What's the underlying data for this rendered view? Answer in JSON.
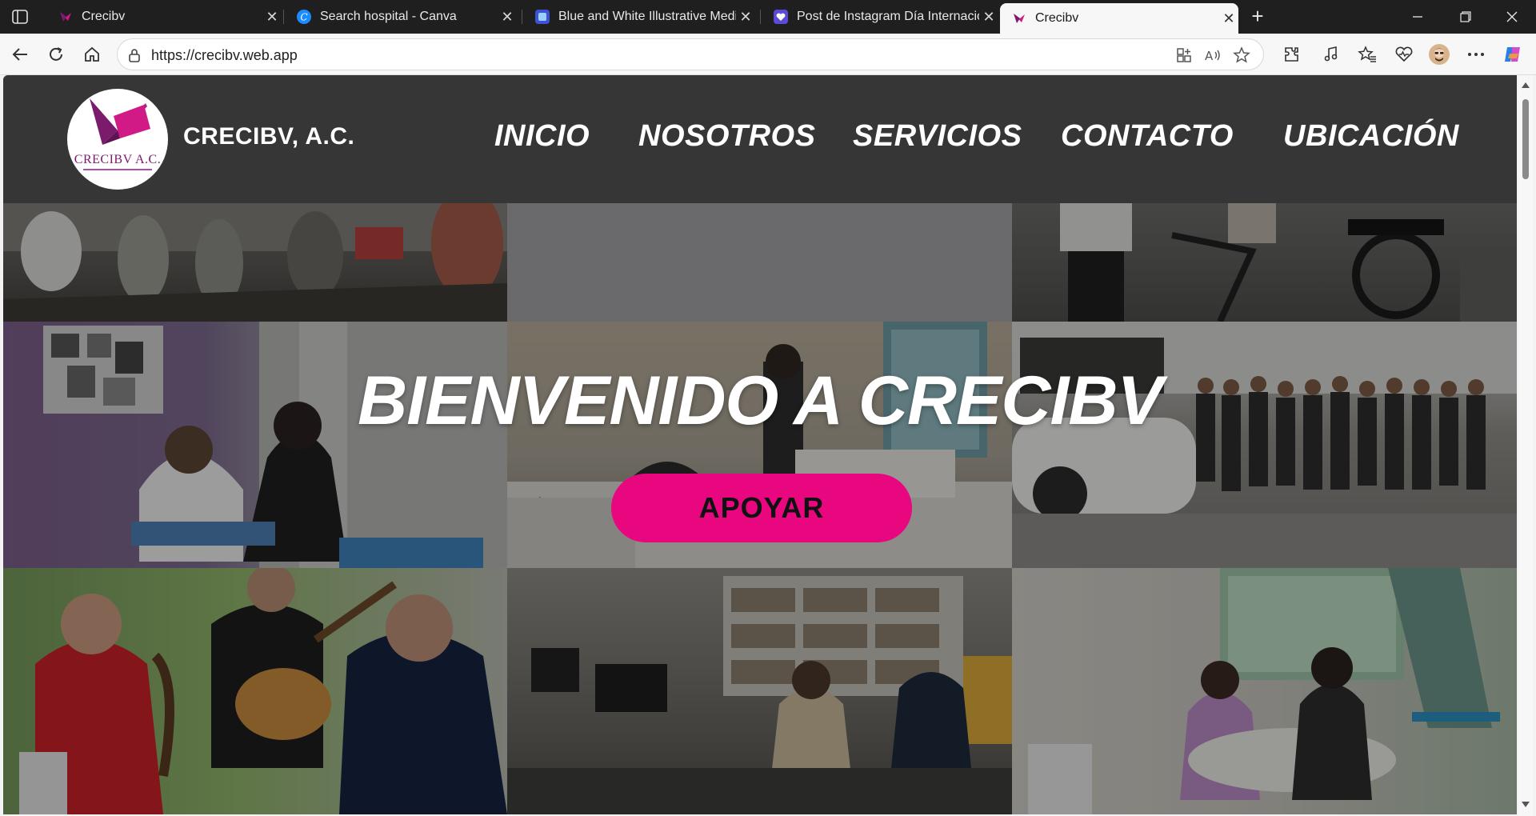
{
  "browser": {
    "tabs": [
      {
        "title": "Crecibv",
        "active": false
      },
      {
        "title": "Search hospital - Canva",
        "active": false
      },
      {
        "title": "Blue and White Illustrative Medical",
        "active": false
      },
      {
        "title": "Post de Instagram Día Internacional",
        "active": false
      },
      {
        "title": "Crecibv",
        "active": true
      }
    ],
    "url": "https://crecibv.web.app"
  },
  "site": {
    "logo_text": "CRECIBV A.C.",
    "brand": "CRECIBV, A.C.",
    "nav": [
      "INICIO",
      "NOSOTROS",
      "SERVICIOS",
      "CONTACTO",
      "UBICACIÓN"
    ],
    "hero_title": "BIENVENIDO A CRECIBV",
    "cta_label": "APOYAR"
  },
  "colors": {
    "accent": "#e8077f",
    "header_bg": "#282828",
    "logo_magenta": "#c8148a"
  }
}
